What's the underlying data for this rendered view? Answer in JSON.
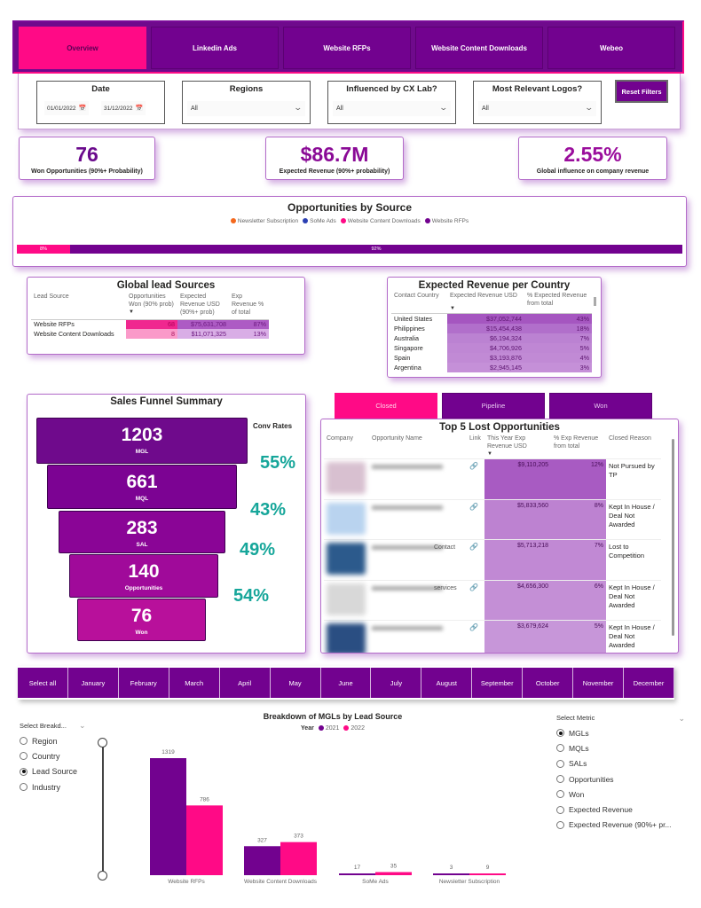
{
  "nav": {
    "tabs": [
      {
        "label": "Overview",
        "active": true
      },
      {
        "label": "Linkedin Ads",
        "active": false
      },
      {
        "label": "Website RFPs",
        "active": false
      },
      {
        "label": "Website Content Downloads",
        "active": false
      },
      {
        "label": "Webeo",
        "active": false
      }
    ]
  },
  "filters": {
    "date": {
      "title": "Date",
      "start": "01/01/2022",
      "end": "31/12/2022"
    },
    "regions": {
      "title": "Regions",
      "value": "All"
    },
    "cx_lab": {
      "title": "Influenced by CX Lab?",
      "value": "All"
    },
    "logos": {
      "title": "Most Relevant Logos?",
      "value": "All"
    },
    "reset_label": "Reset Filters"
  },
  "kpis": [
    {
      "value": "76",
      "label": "Won Opportunities (90%+ Probability)"
    },
    {
      "value": "$86.7M",
      "label": "Expected Revenue (90%+ probability)"
    },
    {
      "value": "2.55%",
      "label": "Global influence on company revenue"
    }
  ],
  "opps_by_source": {
    "title": "Opportunities by Source",
    "legend": [
      {
        "label": "Newsletter Subscription",
        "color": "#f4681d"
      },
      {
        "label": "SoMe Ads",
        "color": "#2b3fb3"
      },
      {
        "label": "Website Content Downloads",
        "color": "#ff0a86"
      },
      {
        "label": "Website RFPs",
        "color": "#72028f"
      }
    ],
    "segments": [
      {
        "label": "8%",
        "share": 8,
        "color": "#ff0a86"
      },
      {
        "label": "92%",
        "share": 92,
        "color": "#72028f"
      }
    ]
  },
  "global_lead_sources": {
    "title": "Global lead Sources",
    "columns": [
      "Lead Source",
      "Opportunities Won (90% prob)",
      "Expected Revenue USD (90%+ prob)",
      "Exp Revenue % of total"
    ],
    "rows": [
      {
        "source": "Website RFPs",
        "won": "68",
        "revenue": "$75,631,708",
        "pct": "87%"
      },
      {
        "source": "Website Content Downloads",
        "won": "8",
        "revenue": "$11,071,325",
        "pct": "13%"
      }
    ]
  },
  "revenue_per_country": {
    "title": "Expected Revenue per Country",
    "columns": [
      "Contact Country",
      "Expected Revenue USD",
      "% Expected Revenue from total"
    ],
    "rows": [
      {
        "country": "United States",
        "revenue": "$37,052,744",
        "pct": "43%"
      },
      {
        "country": "Philippines",
        "revenue": "$15,454,438",
        "pct": "18%"
      },
      {
        "country": "Australia",
        "revenue": "$6,194,324",
        "pct": "7%"
      },
      {
        "country": "Singapore",
        "revenue": "$4,706,926",
        "pct": "5%"
      },
      {
        "country": "Spain",
        "revenue": "$3,193,876",
        "pct": "4%"
      },
      {
        "country": "Argentina",
        "revenue": "$2,945,145",
        "pct": "3%"
      }
    ]
  },
  "funnel": {
    "title": "Sales Funnel Summary",
    "conv_title": "Conv Rates",
    "stages": [
      {
        "value": "1203",
        "label": "MGL",
        "color": "#6f0a8c"
      },
      {
        "value": "661",
        "label": "MQL",
        "color": "#7c0393"
      },
      {
        "value": "283",
        "label": "SAL",
        "color": "#8a0596"
      },
      {
        "value": "140",
        "label": "Opportunities",
        "color": "#a00a9a"
      },
      {
        "value": "76",
        "label": "Won",
        "color": "#b8109b"
      }
    ],
    "conv_rates": [
      "55%",
      "43%",
      "49%",
      "54%"
    ]
  },
  "status_tabs": [
    {
      "label": "Closed",
      "active": true
    },
    {
      "label": "Pipeline",
      "active": false
    },
    {
      "label": "Won",
      "active": false
    }
  ],
  "lost_opps": {
    "title": "Top 5 Lost Opportunities",
    "columns": [
      "Company",
      "Opportunity Name",
      "Link",
      "This Year Exp Revenue USD",
      "% Exp Revenue from total",
      "Closed Reason"
    ],
    "rows": [
      {
        "name_visible": "",
        "revenue": "$9,110,205",
        "pct": "12%",
        "reason": "Not Pursued by TP",
        "logo_color": "#d8c0d0"
      },
      {
        "name_visible": "",
        "revenue": "$5,833,560",
        "pct": "8%",
        "reason": "Kept In House / Deal Not Awarded",
        "logo_color": "#b9d3ef"
      },
      {
        "name_visible": "Contact",
        "revenue": "$5,713,218",
        "pct": "7%",
        "reason": "Lost to Competition",
        "logo_color": "#2c5a8c"
      },
      {
        "name_visible": "services",
        "revenue": "$4,656,300",
        "pct": "6%",
        "reason": "Kept In House / Deal Not Awarded",
        "logo_color": "#d8d8d8"
      },
      {
        "name_visible": "",
        "revenue": "$3,679,624",
        "pct": "5%",
        "reason": "Kept In House / Deal Not Awarded",
        "logo_color": "#2a4e82"
      }
    ]
  },
  "months": [
    "Select all",
    "January",
    "February",
    "March",
    "April",
    "May",
    "June",
    "July",
    "August",
    "September",
    "October",
    "November",
    "December"
  ],
  "breakdown_selector": {
    "title": "Select Breakd...",
    "options": [
      {
        "label": "Region",
        "selected": false
      },
      {
        "label": "Country",
        "selected": false
      },
      {
        "label": "Lead Source",
        "selected": true
      },
      {
        "label": "Industry",
        "selected": false
      }
    ]
  },
  "metric_selector": {
    "title": "Select Metric",
    "options": [
      {
        "label": "MGLs",
        "selected": true
      },
      {
        "label": "MQLs",
        "selected": false
      },
      {
        "label": "SALs",
        "selected": false
      },
      {
        "label": "Opportunities",
        "selected": false
      },
      {
        "label": "Won",
        "selected": false
      },
      {
        "label": "Expected Revenue",
        "selected": false
      },
      {
        "label": "Expected Revenue (90%+ pr...",
        "selected": false
      }
    ]
  },
  "chart_data": {
    "type": "bar",
    "title": "Breakdown of MGLs by Lead Source",
    "legend_title": "Year",
    "legend_position": "top-center",
    "categories": [
      "Website RFPs",
      "Website Content Downloads",
      "SoMe Ads",
      "Newsletter Subscription"
    ],
    "series": [
      {
        "name": "2021",
        "color": "#72028f",
        "values": [
          1319,
          327,
          17,
          3
        ]
      },
      {
        "name": "2022",
        "color": "#ff0a86",
        "values": [
          786,
          373,
          35,
          9
        ]
      }
    ],
    "xlabel": "",
    "ylabel": "",
    "ylim": [
      0,
      1319
    ],
    "grid": false
  }
}
